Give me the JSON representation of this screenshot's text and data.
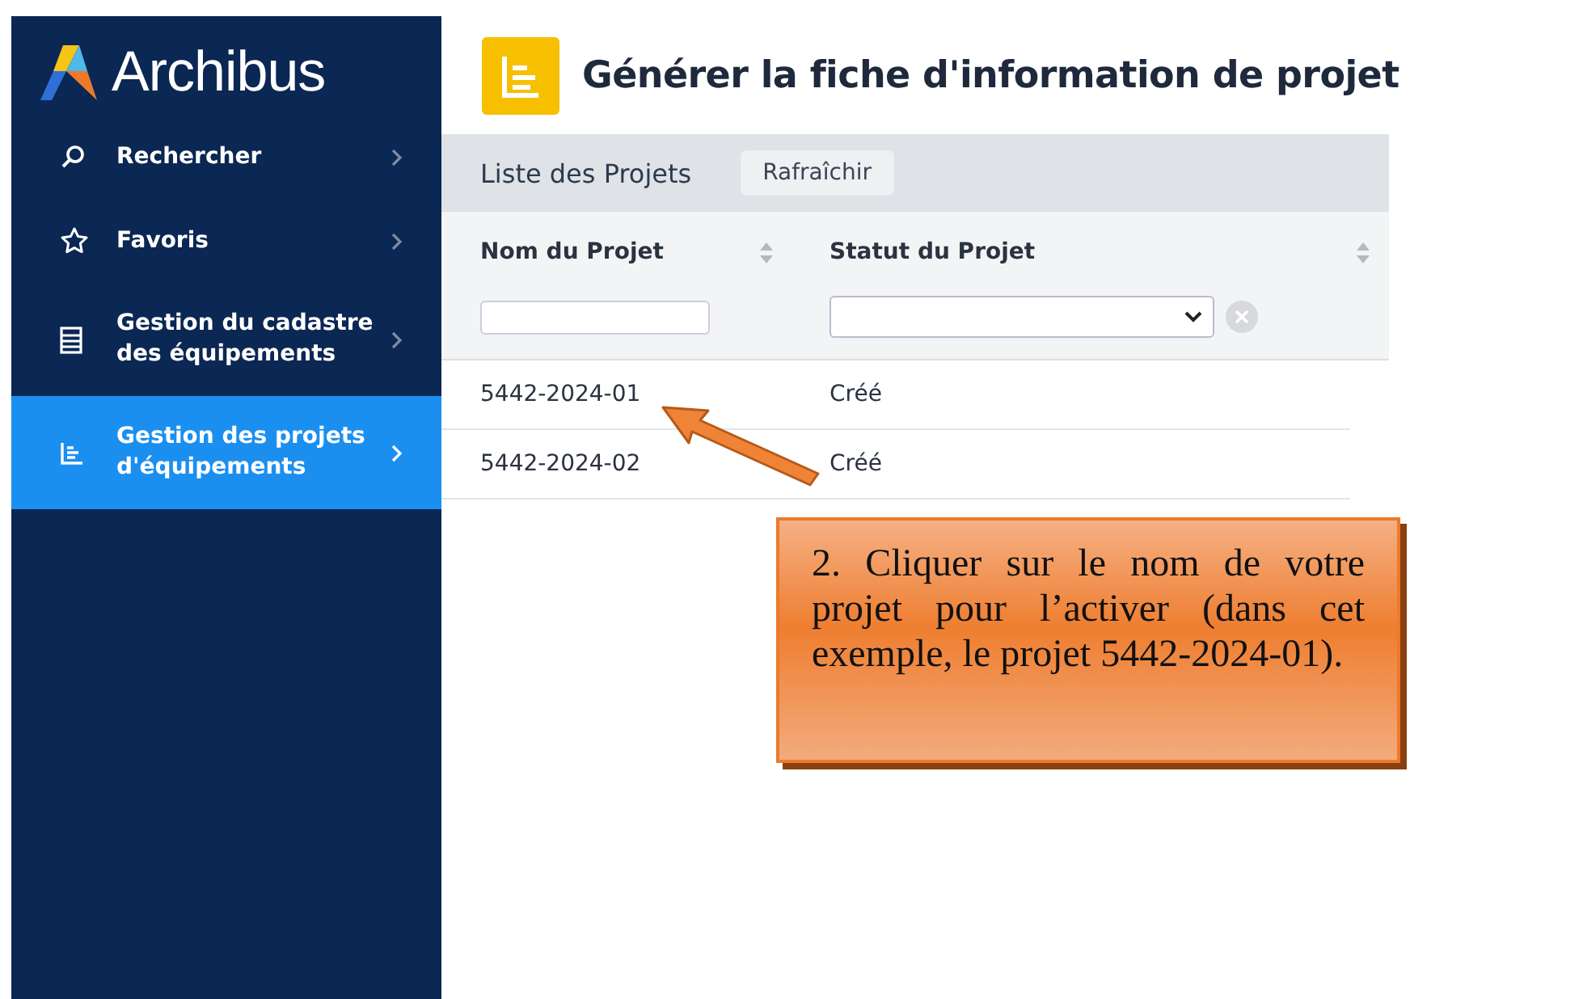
{
  "sidebar": {
    "logo": "Archibus",
    "items": [
      {
        "label": "Rechercher",
        "selected": false
      },
      {
        "label": "Favoris",
        "selected": false
      },
      {
        "label": "Gestion du cadastre des équipements",
        "selected": false
      },
      {
        "label": "Gestion des projets d'équipements",
        "selected": true
      }
    ]
  },
  "page": {
    "title": "Générer la fiche d'information de projet"
  },
  "panel": {
    "title": "Liste des Projets",
    "refresh_button": "Rafraîchir",
    "columns": [
      "Nom du Projet",
      "Statut du Projet"
    ],
    "rows": [
      [
        "5442-2024-01",
        "Créé"
      ],
      [
        "5442-2024-02",
        "Créé"
      ]
    ]
  },
  "callout": {
    "text": "2. Cliquer sur le nom de votre projet pour l’activer (dans cet exemple, le projet 5442-2024-01)."
  }
}
